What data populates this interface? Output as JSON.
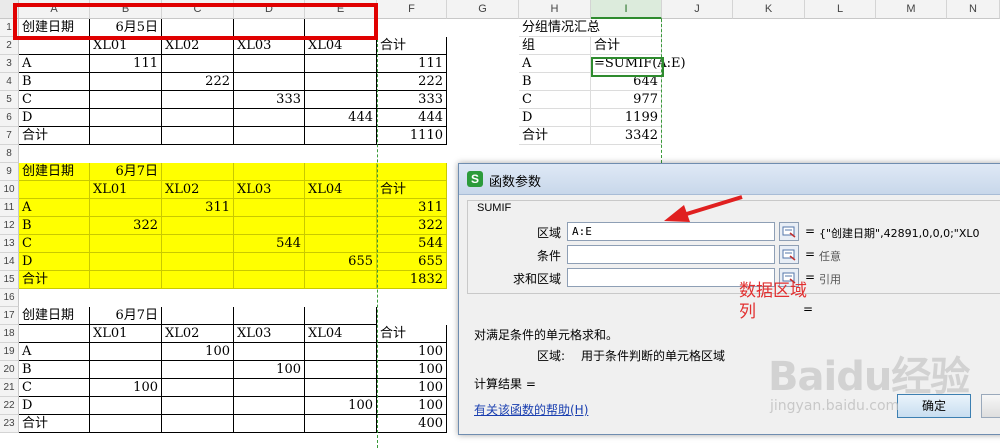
{
  "columns": [
    "A",
    "B",
    "C",
    "D",
    "E",
    "F",
    "G",
    "H",
    "I",
    "J",
    "K",
    "L",
    "M",
    "N"
  ],
  "selected_column": "I",
  "rows": [
    "1",
    "2",
    "3",
    "4",
    "5",
    "6",
    "7",
    "8",
    "9",
    "10",
    "11",
    "12",
    "13",
    "14",
    "15",
    "16",
    "17",
    "18",
    "19",
    "20",
    "21",
    "22",
    "23"
  ],
  "block1": {
    "date_label": "创建日期",
    "date_value": "6月5日",
    "headers": [
      "XL01",
      "XL02",
      "XL03",
      "XL04",
      "合计"
    ],
    "rows": [
      {
        "label": "A",
        "b": "111",
        "c": "",
        "d": "",
        "e": "",
        "f": "111"
      },
      {
        "label": "B",
        "b": "",
        "c": "222",
        "d": "",
        "e": "",
        "f": "222"
      },
      {
        "label": "C",
        "b": "",
        "c": "",
        "d": "333",
        "e": "",
        "f": "333"
      },
      {
        "label": "D",
        "b": "",
        "c": "",
        "d": "",
        "e": "444",
        "f": "444"
      }
    ],
    "total_label": "合计",
    "total_value": "1110"
  },
  "block2": {
    "date_label": "创建日期",
    "date_value": "6月7日",
    "headers": [
      "XL01",
      "XL02",
      "XL03",
      "XL04",
      "合计"
    ],
    "rows": [
      {
        "label": "A",
        "b": "",
        "c": "311",
        "d": "",
        "e": "",
        "f": "311"
      },
      {
        "label": "B",
        "b": "322",
        "c": "",
        "d": "",
        "e": "",
        "f": "322"
      },
      {
        "label": "C",
        "b": "",
        "c": "",
        "d": "544",
        "e": "",
        "f": "544"
      },
      {
        "label": "D",
        "b": "",
        "c": "",
        "d": "",
        "e": "655",
        "f": "655"
      }
    ],
    "total_label": "合计",
    "total_value": "1832"
  },
  "block3": {
    "date_label": "创建日期",
    "date_value": "6月7日",
    "headers": [
      "XL01",
      "XL02",
      "XL03",
      "XL04",
      "合计"
    ],
    "rows": [
      {
        "label": "A",
        "b": "",
        "c": "100",
        "d": "",
        "e": "",
        "f": "100"
      },
      {
        "label": "B",
        "b": "",
        "c": "",
        "d": "100",
        "e": "",
        "f": "100"
      },
      {
        "label": "C",
        "b": "100",
        "c": "",
        "d": "",
        "e": "",
        "f": "100"
      },
      {
        "label": "D",
        "b": "",
        "c": "",
        "d": "",
        "e": "100",
        "f": "100"
      }
    ],
    "total_label": "合计",
    "total_value": "400"
  },
  "summary": {
    "title": "分组情况汇总",
    "col_group": "组",
    "col_total": "合计",
    "formula": "=SUMIF(A:E)",
    "rows": [
      {
        "group": "A",
        "value": ""
      },
      {
        "group": "B",
        "value": "644"
      },
      {
        "group": "C",
        "value": "977"
      },
      {
        "group": "D",
        "value": "1199"
      }
    ],
    "total_label": "合计",
    "total_value": "3342"
  },
  "dialog": {
    "icon_letter": "S",
    "title": "函数参数",
    "function_name": "SUMIF",
    "args": [
      {
        "label": "区域",
        "value": "A:E",
        "result": "{\"创建日期\",42891,0,0,0;\"XL0"
      },
      {
        "label": "条件",
        "value": "",
        "result": "任意"
      },
      {
        "label": "求和区域",
        "value": "",
        "result": "引用"
      }
    ],
    "eq": "=",
    "annotation_1": "数据区域",
    "annotation_2": "列",
    "description": "对满足条件的单元格求和。",
    "arg_help_name": "区域:",
    "arg_help_text": "用于条件判断的单元格区域",
    "result_label": "计算结果 =",
    "help_link": "有关该函数的帮助(H)",
    "ok_label": "确定"
  },
  "watermark": {
    "main": "Baidu经验",
    "sub": "jingyan.baidu.com"
  },
  "colors": {
    "yellow_fill": "#ffff00",
    "active_border": "#2e8b2e",
    "highlight_red": "#e00000",
    "annotation_red": "#e23030"
  }
}
